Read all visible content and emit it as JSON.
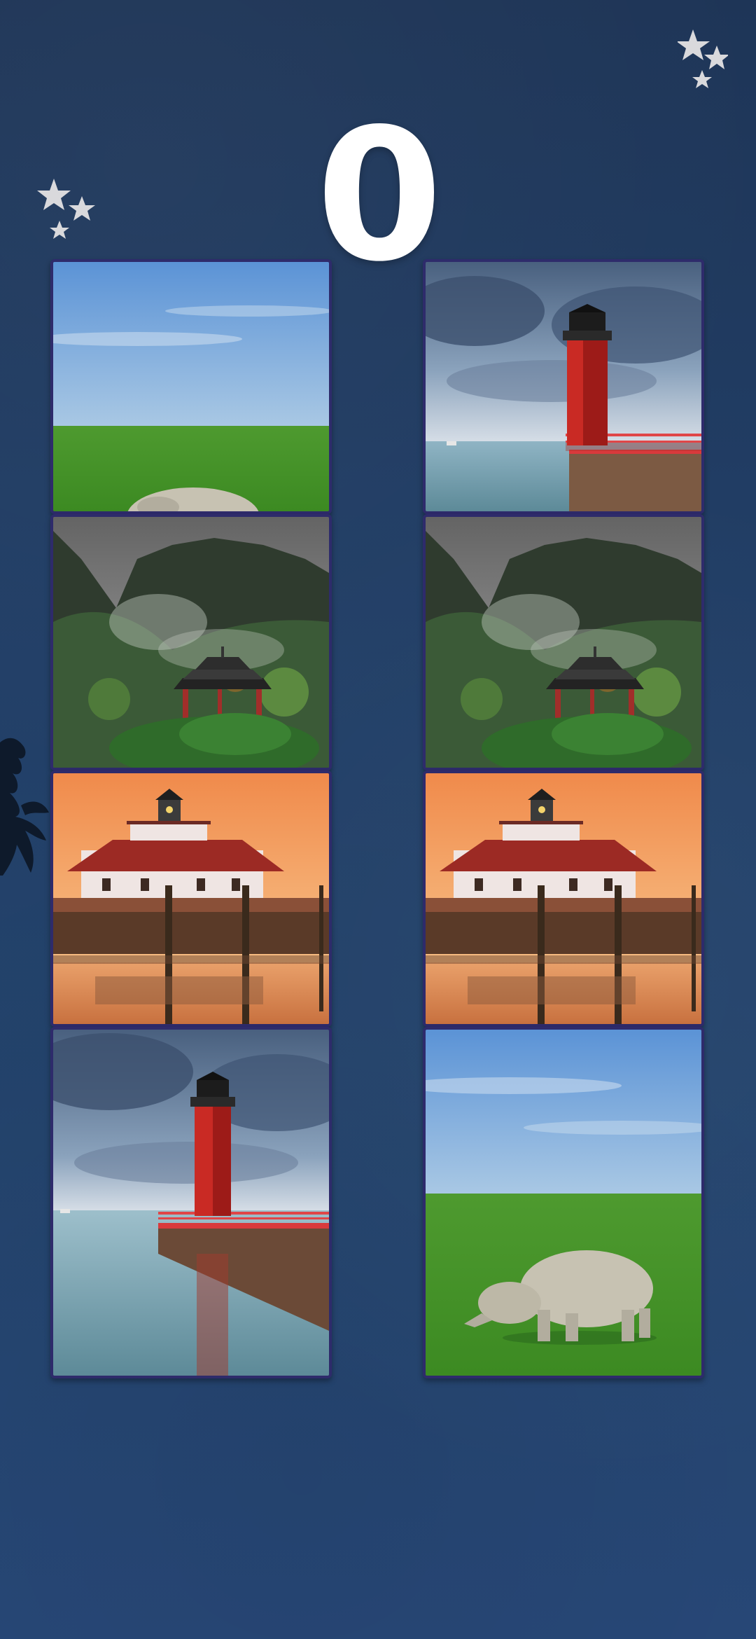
{
  "game": {
    "score": "0"
  },
  "decorations": {
    "stars_top_left": "stars-icon",
    "stars_top_right": "stars-icon",
    "branch": "tree-branch-silhouette"
  },
  "cards": [
    {
      "id": "card-1",
      "picture": "rhino-on-grass",
      "state": "partially-covered"
    },
    {
      "id": "card-2",
      "picture": "red-lighthouse-pier",
      "state": "partially-covered"
    },
    {
      "id": "card-3",
      "picture": "pagoda-misty-mountains",
      "state": "face-up"
    },
    {
      "id": "card-4",
      "picture": "pagoda-misty-mountains",
      "state": "face-up"
    },
    {
      "id": "card-5",
      "picture": "lighthouse-house-sunset",
      "state": "face-up"
    },
    {
      "id": "card-6",
      "picture": "lighthouse-house-sunset",
      "state": "face-up"
    },
    {
      "id": "card-7",
      "picture": "red-lighthouse-pier",
      "state": "face-up"
    },
    {
      "id": "card-8",
      "picture": "rhino-on-grass",
      "state": "face-up"
    }
  ]
}
